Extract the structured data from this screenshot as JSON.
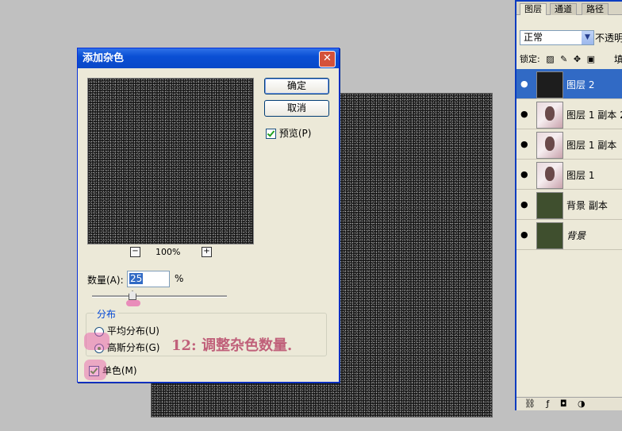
{
  "dialog": {
    "title": "添加杂色",
    "close_glyph": "✕",
    "ok_label": "确定",
    "cancel_label": "取消",
    "preview_label": "预览(P)",
    "zoom_out_glyph": "−",
    "zoom_in_glyph": "+",
    "zoom_value": "100%",
    "amount_label": "数量(A):",
    "amount_value": "25",
    "amount_unit": "%",
    "distribution_title": "分布",
    "uniform_label": "平均分布(U)",
    "gaussian_label": "高斯分布(G)",
    "mono_label": "单色(M)"
  },
  "annotation": "12: 调整杂色数量.",
  "layers_panel": {
    "tabs": [
      "图层",
      "通道",
      "路径"
    ],
    "blend_mode": "正常",
    "opacity_label": "不透明",
    "lock_label": "锁定:",
    "fill_label": "填",
    "layers": [
      {
        "name": "图层 2",
        "thumb": "dark",
        "selected": true
      },
      {
        "name": "图层 1 副本 2",
        "thumb": "photo",
        "selected": false
      },
      {
        "name": "图层 1 副本",
        "thumb": "photo",
        "selected": false
      },
      {
        "name": "图层 1",
        "thumb": "photo",
        "selected": false
      },
      {
        "name": "背景 副本",
        "thumb": "green",
        "selected": false
      },
      {
        "name": "背景",
        "thumb": "green",
        "selected": false
      }
    ],
    "eye_glyph": "👁",
    "footer_icons": [
      "link-icon",
      "fx-icon",
      "mask-icon",
      "adjustment-icon"
    ]
  },
  "colors": {
    "titlebar": "#0a4fd4",
    "selection": "#316ac5",
    "annotation": "#c0607a",
    "marker": "#e85aaa"
  }
}
